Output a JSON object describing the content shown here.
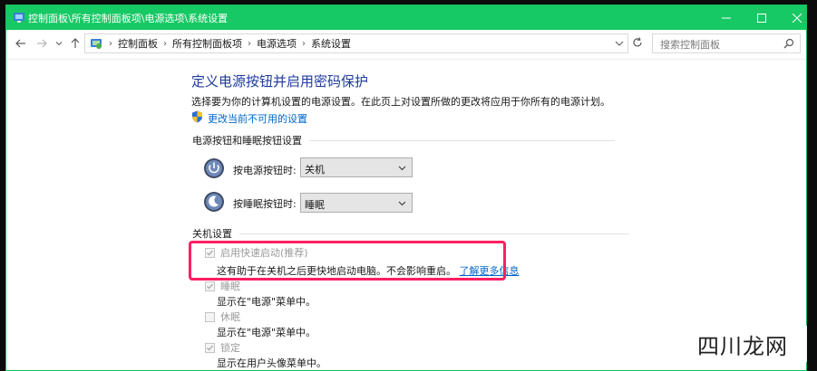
{
  "window": {
    "title": "控制面板\\所有控制面板项\\电源选项\\系统设置",
    "titlebar_color": "#17c964"
  },
  "navbar": {
    "breadcrumbs": [
      "控制面板",
      "所有控制面板项",
      "电源选项",
      "系统设置"
    ],
    "search_placeholder": "搜索控制面板"
  },
  "page": {
    "title": "定义电源按钮并启用密码保护",
    "description": "选择要为你的计算机设置的电源设置。在此页上对设置所做的更改将应用于你所有的电源计划。",
    "change_link": "更改当前不可用的设置",
    "power_section": {
      "header": "电源按钮和睡眠按钮设置",
      "power_button_label": "按电源按钮时:",
      "power_button_value": "关机",
      "sleep_button_label": "按睡眠按钮时:",
      "sleep_button_value": "睡眠"
    },
    "shutdown_section": {
      "header": "关机设置",
      "items": [
        {
          "label": "启用快速启动(推荐)",
          "description": "这有助于在关机之后更快地启动电脑。不会影响重启。",
          "link": "了解更多信息",
          "checked": true,
          "enabled": false
        },
        {
          "label": "睡眠",
          "description": "显示在\"电源\"菜单中。",
          "checked": true,
          "enabled": false
        },
        {
          "label": "休眠",
          "description": "显示在\"电源\"菜单中。",
          "checked": false,
          "enabled": false
        },
        {
          "label": "锁定",
          "description": "显示在用户头像菜单中。",
          "checked": true,
          "enabled": false
        }
      ]
    }
  },
  "highlight_color": "#ff1f62",
  "link_color": "#0066cc",
  "title_color": "#1f3a9e",
  "watermark": "四川龙网"
}
